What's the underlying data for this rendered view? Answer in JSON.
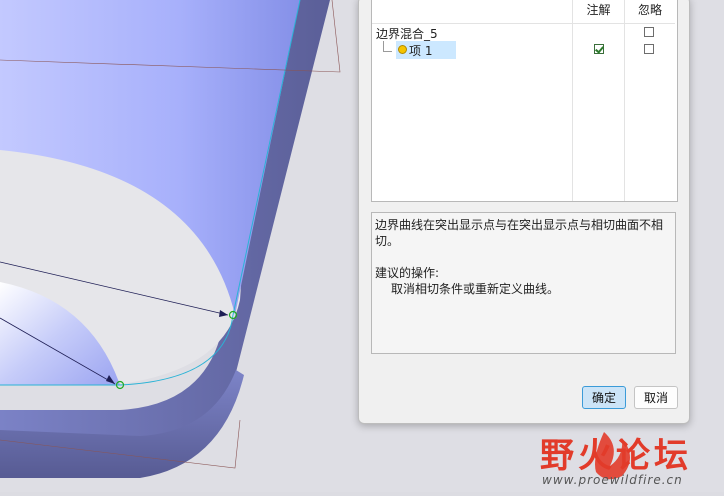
{
  "dialog": {
    "columns": {
      "annotate": "注解",
      "ignore": "忽略"
    },
    "tree": {
      "root_label": "边界混合_5",
      "items": [
        {
          "label": "项 1",
          "annotate_checked": true,
          "ignore_checked": false
        }
      ],
      "root_ignore_checked": false
    },
    "message": {
      "line1": "边界曲线在突出显示点与在突出显示点与相切曲面不相",
      "line2": "切。",
      "suggest_title": "建议的操作:",
      "suggest_body": "取消相切条件或重新定义曲线。"
    },
    "buttons": {
      "ok": "确定",
      "cancel": "取消"
    }
  },
  "watermark": {
    "title": "野火论坛",
    "url": "www.proewildfire.cn"
  },
  "colors": {
    "surface_blue": "#a3adf7",
    "edge_cyan": "#2ab3d6",
    "dialog_bg": "#f0f0f0",
    "ok_highlight": "#cce4f7",
    "logo_red": "#e23b2a"
  }
}
